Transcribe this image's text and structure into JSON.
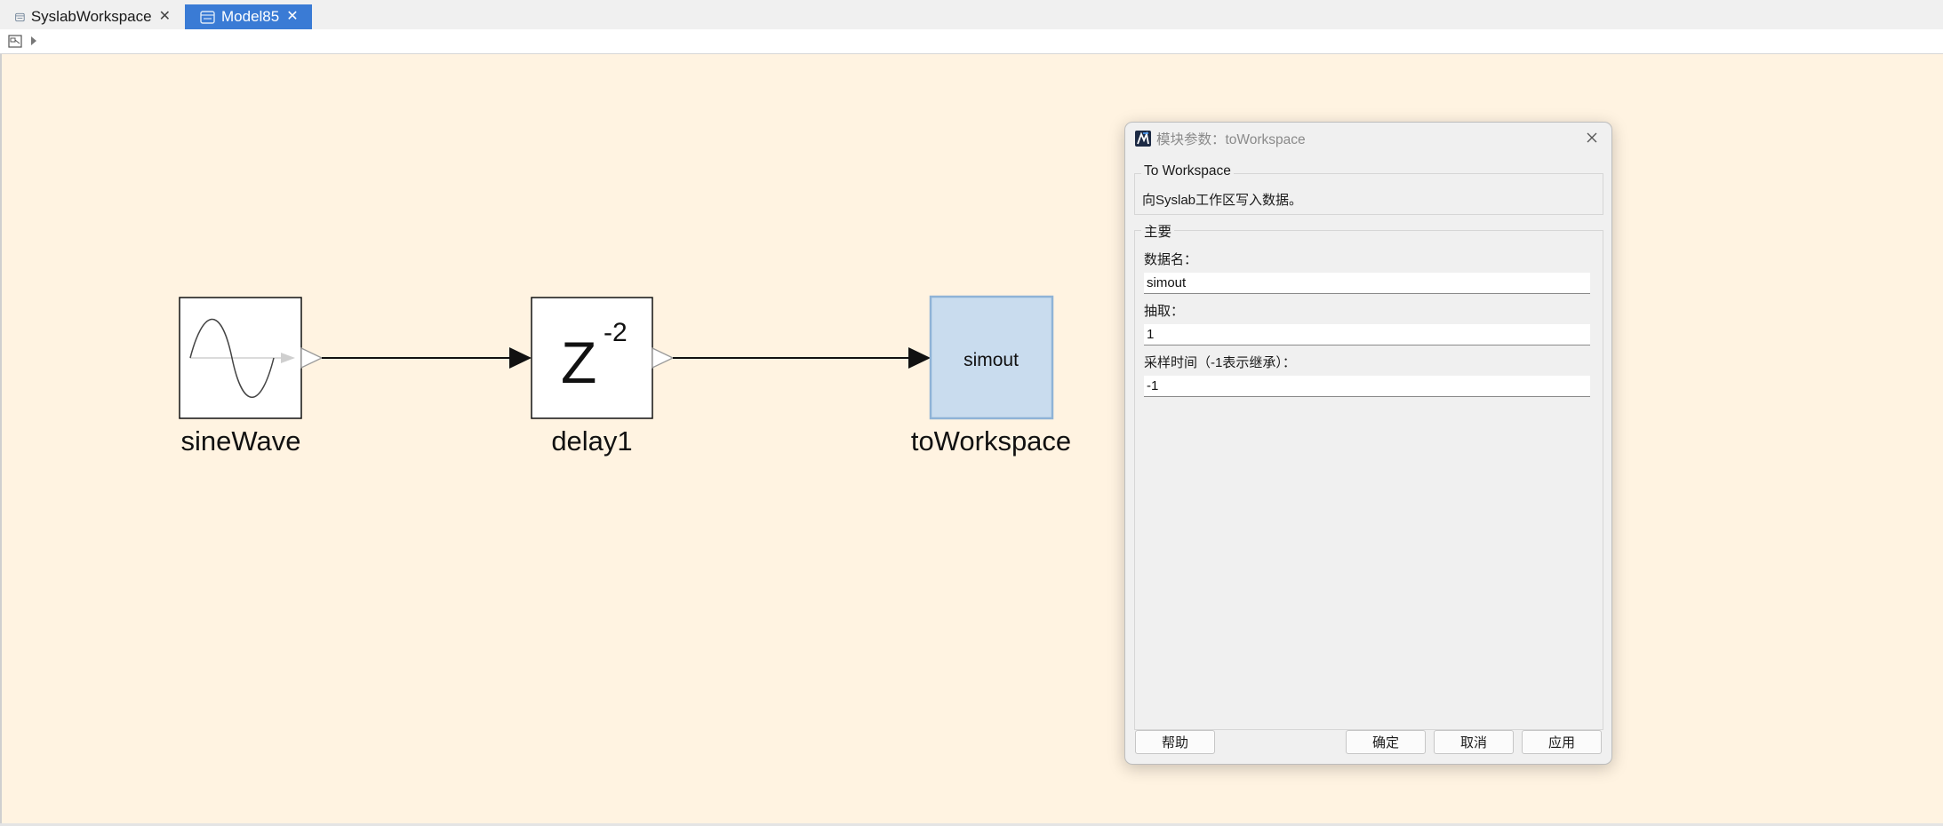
{
  "tabs": [
    {
      "label": "SyslabWorkspace",
      "active": false
    },
    {
      "label": "Model85",
      "active": true
    }
  ],
  "icons": {
    "tab_icon": "model-file-icon",
    "tab_close": "close-icon",
    "breadcrumb_icon": "model-browser-icon",
    "breadcrumb_arrow": "chevron-right-icon",
    "dialog_logo": "mworks-logo-icon",
    "dialog_close": "close-icon"
  },
  "colors": {
    "canvas_background": "#fff3e1",
    "active_tab": "#3a7bd5",
    "selected_block": "#c9dcee"
  },
  "diagram": {
    "blocks": [
      {
        "name": "sineWave",
        "label": "sineWave"
      },
      {
        "name": "delay1",
        "label": "delay1",
        "glyph_main": "Z",
        "glyph_exponent": "-2"
      },
      {
        "name": "toWorkspace",
        "label": "toWorkspace",
        "inner_text": "simout",
        "selected": true
      }
    ]
  },
  "dialog": {
    "title": "模块参数：toWorkspace",
    "description_group": {
      "legend": "To Workspace",
      "text": "向Syslab工作区写入数据。"
    },
    "main_group": {
      "legend": "主要",
      "fields": [
        {
          "label": "数据名：",
          "value": "simout"
        },
        {
          "label": "抽取：",
          "value": "1"
        },
        {
          "label": "采样时间（-1表示继承）：",
          "value": "-1"
        }
      ]
    },
    "buttons": {
      "help": "帮助",
      "ok": "确定",
      "cancel": "取消",
      "apply": "应用"
    }
  }
}
